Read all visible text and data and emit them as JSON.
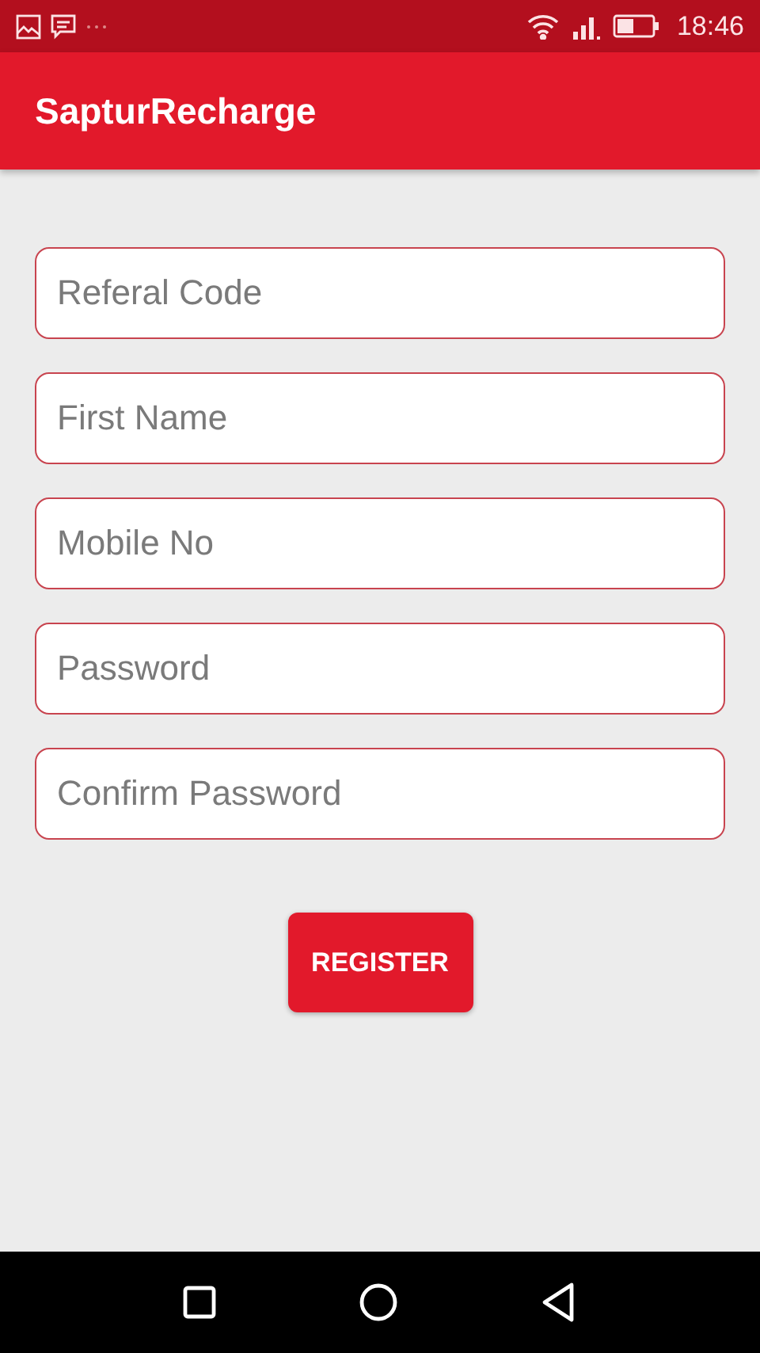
{
  "status_bar": {
    "time": "18:46"
  },
  "app_bar": {
    "title": "SapturRecharge"
  },
  "form": {
    "fields": [
      {
        "placeholder": "Referal Code"
      },
      {
        "placeholder": "First Name"
      },
      {
        "placeholder": "Mobile No"
      },
      {
        "placeholder": "Password"
      },
      {
        "placeholder": "Confirm Password"
      }
    ],
    "submit": "REGISTER"
  }
}
